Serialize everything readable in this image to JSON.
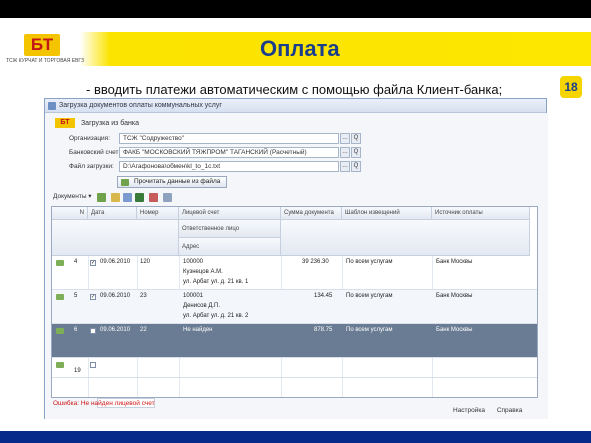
{
  "slide": {
    "title": "Оплата",
    "page_number": "18",
    "bullet": "- вводить платежи автоматическим с помощью файла Клиент-банка;",
    "logo_mark": "БТ",
    "logo_text": "ТСЖ КУРЧАТ И ТОРГОВАЯ ЕВГЗ"
  },
  "window": {
    "title": "Загрузка документов оплаты коммунальных услуг",
    "subtitle": "Загрузка из банка",
    "fields": [
      {
        "label": "Организация:",
        "value": "ТСЖ \"Содружество\""
      },
      {
        "label": "Банковский счет:",
        "value": "ФАКБ \"МОСКОВСКИЙ ТЯЖПРОМ\" ТАГАНСКИЙ (Расчетный)"
      },
      {
        "label": "Файл загрузки:",
        "value": "D:\\Агафонова\\обмен\\kl_to_1c.txt"
      }
    ],
    "read_button": "Прочитать данные из файла",
    "toolbar": {
      "documents_menu": "Документы ▾"
    },
    "columns": [
      "N",
      "Дата",
      "Номер",
      "Лицевой счет",
      "Сумма документа",
      "Шаблон извещений",
      "Источник оплаты"
    ],
    "subcolumns": [
      "Ответственное лицо",
      "Адрес"
    ],
    "rows": [
      {
        "n": "4",
        "date": "09.06.2010",
        "number": "120",
        "account": "100000",
        "person": "Кузнецов А.М.",
        "address": "ул. Арбат ул. д. 21 кв. 1",
        "sum": "39 236.30",
        "template": "По всем услугам",
        "source": "Банк Москвы"
      },
      {
        "n": "5",
        "date": "09.06.2010",
        "number": "23",
        "account": "100001",
        "person": "Денисов Д.П.",
        "address": "ул. Арбат ул. д. 21 кв. 2",
        "sum": "134.45",
        "template": "По всем услугам",
        "source": "Банк Москвы"
      },
      {
        "n": "6",
        "date": "09.06.2010",
        "number": "22",
        "account": "Не найден",
        "person": "",
        "address": "",
        "sum": "878.75",
        "template": "По всем услугам",
        "source": "Банк Москвы"
      }
    ],
    "partial_row_n": "19",
    "error_text": "Ошибка: Не найден лицевой счет",
    "footer": {
      "settings": "Настройка",
      "help": "Справка"
    }
  }
}
